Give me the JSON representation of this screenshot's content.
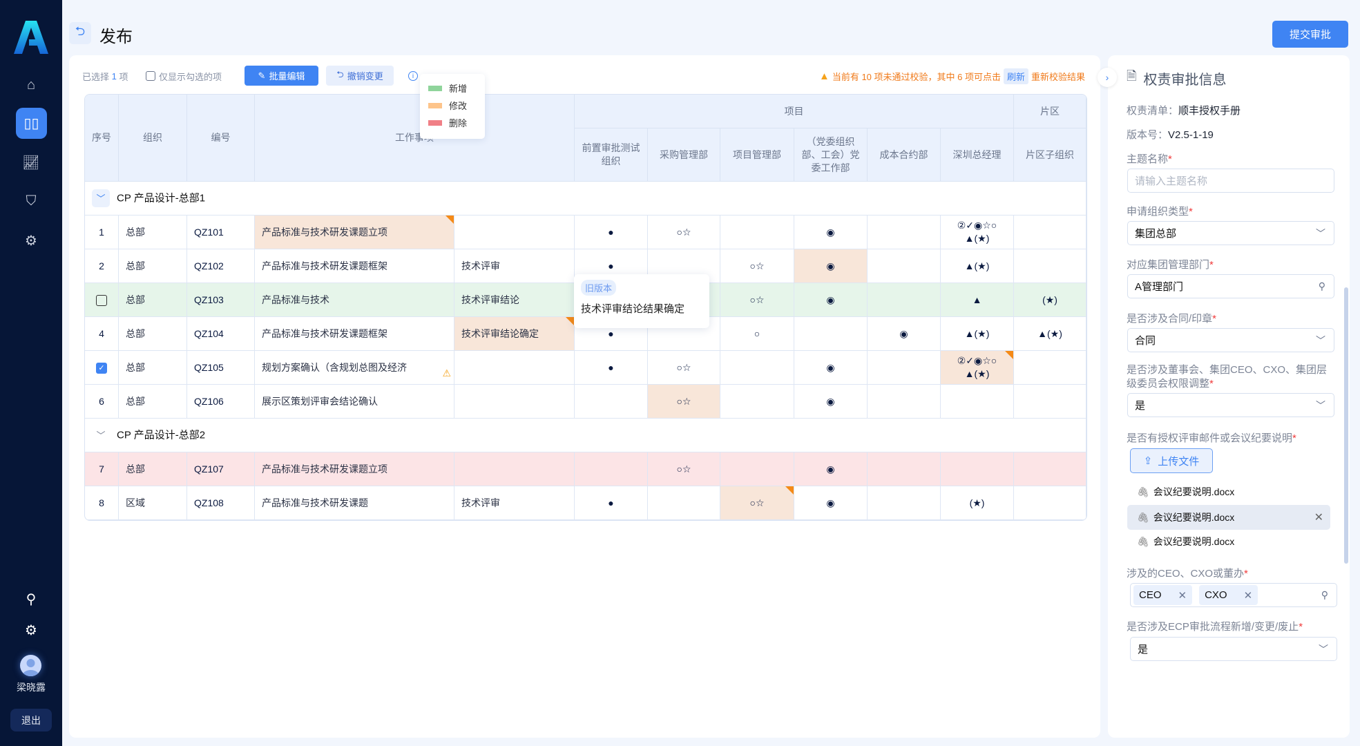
{
  "sidebar": {
    "user_name": "梁晓露",
    "logout": "退出",
    "icons": [
      "home-icon",
      "book-icon",
      "chart-icon",
      "shield-icon",
      "gear-icon",
      "search-icon",
      "settings-icon"
    ],
    "active": "book-icon"
  },
  "header": {
    "title": "发布",
    "submit": "提交审批"
  },
  "toolbar": {
    "selected_prefix": "已选择",
    "selected_count": "1",
    "selected_suffix": "项",
    "only_checked": "仅显示勾选的项",
    "batch_edit": "批量编辑",
    "undo": "撤销变更",
    "warning": {
      "part1": "当前有 10 项未通过校验，其中 6 项可点击",
      "refresh": "刷新",
      "part2": "重新校验结果"
    }
  },
  "legend": [
    {
      "label": "新增",
      "color": "#8fd49b"
    },
    {
      "label": "修改",
      "color": "#fdc48a"
    },
    {
      "label": "删除",
      "color": "#f07f86"
    }
  ],
  "table": {
    "headers": {
      "seq": "序号",
      "org": "组织",
      "code": "编号",
      "work": "工作事项",
      "project": "项目",
      "area": "片区",
      "sub": [
        "前置审批测试组织",
        "采购管理部",
        "项目管理部",
        "（党委组织部、工会）党委工作部",
        "成本合约部",
        "深圳总经理",
        "片区子组织"
      ]
    },
    "colors": {
      "modified": "#f8e6d9",
      "added": "#e6f5ea",
      "deleted": "#fce4e6",
      "flag": "#f58a17"
    },
    "groups": [
      {
        "title": "CP 产品设计-总部1",
        "rows": [
          {
            "cells": [
              "1",
              "总部",
              "QZ101",
              "产品标准与技术研发课题立项",
              "",
              "●",
              "○☆",
              "",
              "◉",
              "",
              "②✓◉☆○\n▲(★)",
              ""
            ],
            "modified": [
              3
            ],
            "flagged": [
              3
            ]
          },
          {
            "cells": [
              "2",
              "总部",
              "QZ102",
              "产品标准与技术研发课题框架",
              "技术评审",
              "●",
              "",
              "○☆",
              "◉",
              "",
              "▲(★)",
              ""
            ],
            "modified": [
              8
            ],
            "flagged": []
          },
          {
            "cells": [
              "",
              "总部",
              "QZ103",
              "产品标准与技术",
              "技术评审结论",
              "",
              "",
              "○☆",
              "◉",
              "",
              "▲",
              "(★)"
            ],
            "status": "added",
            "checkbox": false,
            "modified": [],
            "flagged": []
          },
          {
            "cells": [
              "4",
              "总部",
              "QZ104",
              "产品标准与技术研发课题框架",
              "技术评审结论确定",
              "●",
              "",
              "○",
              "",
              "◉",
              "▲(★)",
              "▲(★)"
            ],
            "modified": [
              4
            ],
            "flagged": [
              4
            ]
          },
          {
            "cells": [
              "",
              "总部",
              "QZ105",
              "规划方案确认（含规划总图及经济",
              "",
              "●",
              "○☆",
              "",
              "◉",
              "",
              "②✓◉☆○\n▲(★)",
              ""
            ],
            "checkbox": true,
            "warning": true,
            "modified": [
              10
            ],
            "flagged": [
              10
            ]
          },
          {
            "cells": [
              "6",
              "总部",
              "QZ106",
              "展示区策划评审会结论确认",
              "",
              "",
              "○☆",
              "",
              "◉",
              "",
              "",
              ""
            ],
            "modified": [
              6
            ],
            "flagged": []
          }
        ]
      },
      {
        "title": "CP 产品设计-总部2",
        "rows": [
          {
            "cells": [
              "7",
              "总部",
              "QZ107",
              "产品标准与技术研发课题立项",
              "",
              "",
              "○☆",
              "",
              "◉",
              "",
              "",
              ""
            ],
            "status": "deleted",
            "modified": [],
            "flagged": []
          },
          {
            "cells": [
              "8",
              "区域",
              "QZ108",
              "产品标准与技术研发课题",
              "技术评审",
              "●",
              "",
              "○☆",
              "◉",
              "",
              "(★)",
              ""
            ],
            "modified": [
              7
            ],
            "flagged": [
              7
            ]
          }
        ]
      }
    ]
  },
  "tooltip": {
    "tag": "旧版本",
    "text": "技术评审结论结果确定"
  },
  "panel": {
    "title": "权责审批信息",
    "list_label": "权责清单：",
    "list_value": "顺丰授权手册",
    "version_label": "版本号：",
    "version_value": "V2.5-1-19",
    "fields": {
      "subject": {
        "label": "主题名称",
        "placeholder": "请输入主题名称"
      },
      "org_type": {
        "label": "申请组织类型",
        "value": "集团总部"
      },
      "dept": {
        "label": "对应集团管理部门",
        "value": "A管理部门"
      },
      "contract": {
        "label": "是否涉及合同/印章",
        "value": "合同"
      },
      "board": {
        "label": "是否涉及董事会、集团CEO、CXO、集团层级委员会权限调整",
        "value": "是"
      },
      "attach": {
        "label": "是否有授权评审邮件或会议纪要说明",
        "upload": "上传文件",
        "files": [
          "会议纪要说明.docx",
          "会议纪要说明.docx",
          "会议纪要说明.docx"
        ]
      },
      "cxo": {
        "label": "涉及的CEO、CXO或董办",
        "tags": [
          "CEO",
          "CXO"
        ]
      },
      "ecp": {
        "label": "是否涉及ECP审批流程新增/变更/废止",
        "value": "是"
      }
    },
    "required_mark": "*"
  }
}
